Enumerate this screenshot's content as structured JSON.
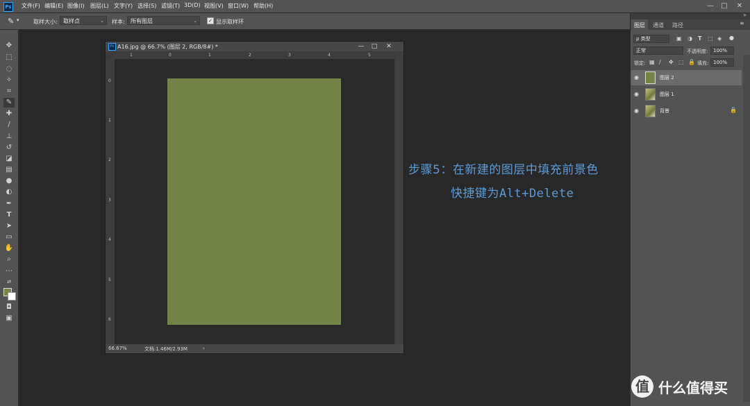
{
  "menubar": {
    "items": [
      "文件(F)",
      "编辑(E)",
      "图像(I)",
      "图层(L)",
      "文字(Y)",
      "选择(S)",
      "滤镜(T)",
      "3D(D)",
      "视图(V)",
      "窗口(W)",
      "帮助(H)"
    ],
    "logo": "Ps",
    "win_min": "—",
    "win_max": "□",
    "win_close": "✕"
  },
  "options": {
    "sample_size_label": "取样大小:",
    "sample_size_value": "取样点",
    "sample_label": "样本:",
    "sample_value": "所有图层",
    "show_ring_label": "显示取样环"
  },
  "document": {
    "title": "A16.jpg @ 66.7% (图层 2, RGB/8#) *",
    "zoom": "66.67%",
    "doc_info": "文档:1.46M/2.93M",
    "canvas_color": "#738446",
    "ruler_top_ticks": [
      "1",
      "0",
      "1",
      "2",
      "3",
      "4",
      "5"
    ],
    "ruler_left_ticks": [
      "0",
      "1",
      "2",
      "3",
      "4",
      "5",
      "6"
    ]
  },
  "panel": {
    "tabs": [
      "图层",
      "通道",
      "路径"
    ],
    "filter_label": "ρ 类型",
    "blend_mode": "正常",
    "opacity_label": "不透明度:",
    "opacity_value": "100%",
    "lock_label": "锁定:",
    "fill_label": "填充:",
    "fill_value": "100%",
    "layers": [
      {
        "name": "图层 2",
        "selected": true
      },
      {
        "name": "图层 1",
        "selected": false
      },
      {
        "name": "背景",
        "selected": false,
        "locked": true
      }
    ]
  },
  "overlay": {
    "line1": "步骤5：在新建的图层中填充前景色",
    "line2_prefix": "快捷键为",
    "line2_keys": "Alt+Delete"
  },
  "watermark": {
    "glyph": "值",
    "text": "什么值得买"
  },
  "colors": {
    "foreground": "#738446",
    "background": "#ffffff",
    "accent_text": "#5b9ad6"
  }
}
